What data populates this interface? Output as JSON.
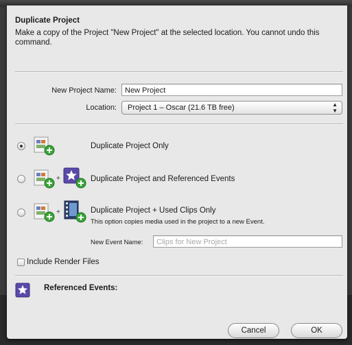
{
  "dialog": {
    "title": "Duplicate Project",
    "description": "Make a copy of the Project \"New Project\" at the selected location. You cannot undo this command."
  },
  "form": {
    "project_name_label": "New Project Name:",
    "project_name_value": "New Project",
    "location_label": "Location:",
    "location_value": "Project 1 – Oscar   (21.6 TB free)"
  },
  "options": [
    {
      "label": "Duplicate Project Only",
      "selected": true,
      "icons": [
        "project-icon"
      ]
    },
    {
      "label": "Duplicate Project and Referenced Events",
      "selected": false,
      "icons": [
        "project-icon",
        "event-star-icon"
      ]
    },
    {
      "label": "Duplicate Project + Used Clips Only",
      "selected": false,
      "icons": [
        "project-icon",
        "film-clip-icon"
      ],
      "note": "This option copies media used in the project to a new Event."
    }
  ],
  "new_event": {
    "label": "New Event Name:",
    "placeholder": "Clips for New Project"
  },
  "render_files": {
    "label": "Include Render Files",
    "checked": false
  },
  "referenced_events": {
    "label": "Referenced Events:"
  },
  "buttons": {
    "cancel": "Cancel",
    "ok": "OK"
  },
  "colors": {
    "sheet": "#e8e8e8",
    "backdrop": "#3b3b3b",
    "project_icon_green": "#3aa63a",
    "event_icon_purple": "#5a4aa8"
  }
}
